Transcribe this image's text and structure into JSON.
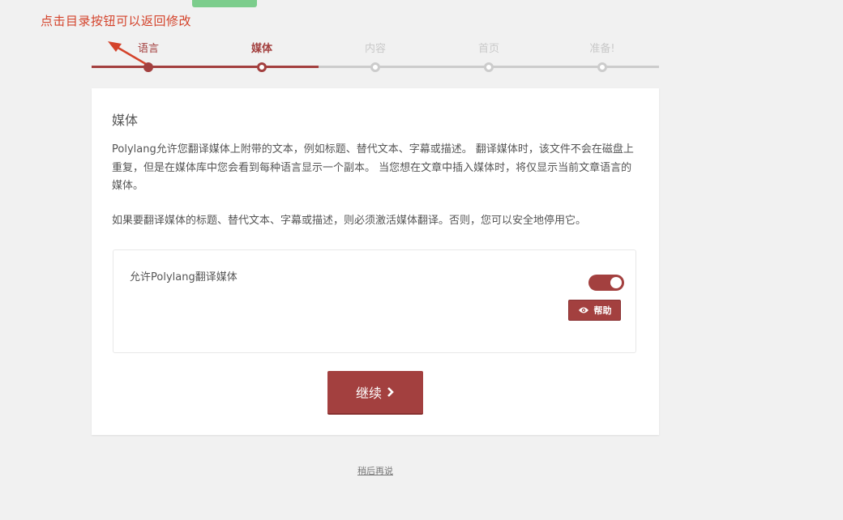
{
  "annotation": {
    "text": "点击目录按钮可以返回修改"
  },
  "steps": [
    {
      "label": "语言",
      "state": "done"
    },
    {
      "label": "媒体",
      "state": "active"
    },
    {
      "label": "内容",
      "state": "todo"
    },
    {
      "label": "首页",
      "state": "todo"
    },
    {
      "label": "准备!",
      "state": "todo"
    }
  ],
  "card": {
    "title": "媒体",
    "description": "Polylang允许您翻译媒体上附带的文本，例如标题、替代文本、字幕或描述。 翻译媒体时，该文件不会在磁盘上重复，但是在媒体库中您会看到每种语言显示一个副本。 当您想在文章中插入媒体时，将仅显示当前文章语言的媒体。",
    "description2": "如果要翻译媒体的标题、替代文本、字幕或描述，则必须激活媒体翻译。否则，您可以安全地停用它。",
    "option": {
      "label": "允许Polylang翻译媒体",
      "enabled": true,
      "help_label": "帮助",
      "help_icon": "eye-icon"
    },
    "continue_label": "继续",
    "continue_icon": "chevron-right-icon"
  },
  "footer": {
    "later_link": "稍后再说"
  },
  "colors": {
    "accent": "#a3403f",
    "annotation": "#d4432b",
    "track": "#cccccc"
  }
}
